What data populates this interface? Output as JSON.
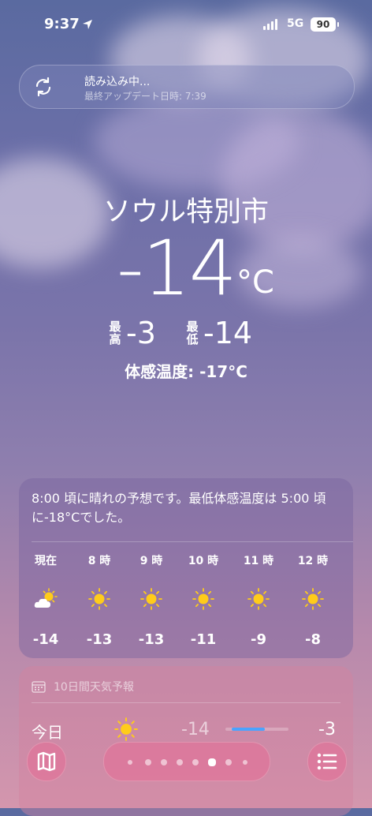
{
  "status_bar": {
    "time": "9:37",
    "network": "5G",
    "battery": "90"
  },
  "loading_banner": {
    "title": "読み込み中...",
    "subtitle": "最終アップデート日時: 7:39"
  },
  "current": {
    "city": "ソウル特別市",
    "temperature": "-14",
    "unit": "°C",
    "high_label": "最高",
    "high": "-3",
    "low_label": "最低",
    "low": "-14",
    "feels_like": "体感温度: -17°C"
  },
  "hourly": {
    "summary": "8:00 頃に晴れの予想です。最低体感温度は 5:00 頃に-18°Cでした。",
    "items": [
      {
        "label": "現在",
        "icon": "partly-cloudy-icon",
        "temp": "-14"
      },
      {
        "label": "8 時",
        "icon": "sun-icon",
        "temp": "-13"
      },
      {
        "label": "9 時",
        "icon": "sun-icon",
        "temp": "-13"
      },
      {
        "label": "10 時",
        "icon": "sun-icon",
        "temp": "-11"
      },
      {
        "label": "11 時",
        "icon": "sun-icon",
        "temp": "-9"
      },
      {
        "label": "12 時",
        "icon": "sun-icon",
        "temp": "-8"
      }
    ]
  },
  "daily": {
    "title": "10日間天気予報",
    "rows": [
      {
        "day": "今日",
        "icon": "sun-icon",
        "low": "-14",
        "high": "-3"
      }
    ]
  },
  "bottom_bar": {
    "page_count": 7,
    "active_page": 5
  },
  "colors": {
    "accent_bar": "#4aa3ff",
    "sun": "#ffcc1a"
  }
}
